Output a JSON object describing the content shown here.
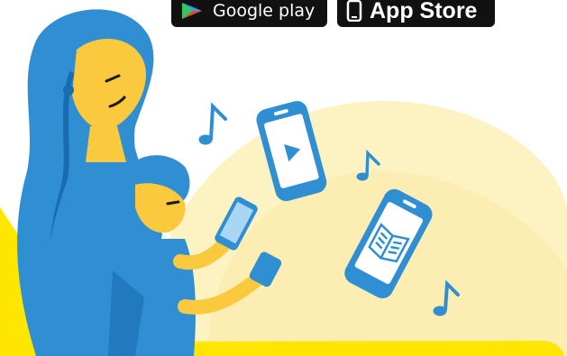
{
  "store_badges": {
    "google_play": {
      "label": "Google play",
      "icon": "play-triangle-icon"
    },
    "app_store": {
      "label": "App Store",
      "icon": "phone-icon"
    }
  },
  "colors": {
    "background": "#ffffff",
    "sun_glow": "#fdf3c2",
    "accent_yellow": "#ffe600",
    "skin": "#fbc93e",
    "blue": "#2f8fd2",
    "blue_dark": "#1a6bb0",
    "badge": "#111111"
  }
}
